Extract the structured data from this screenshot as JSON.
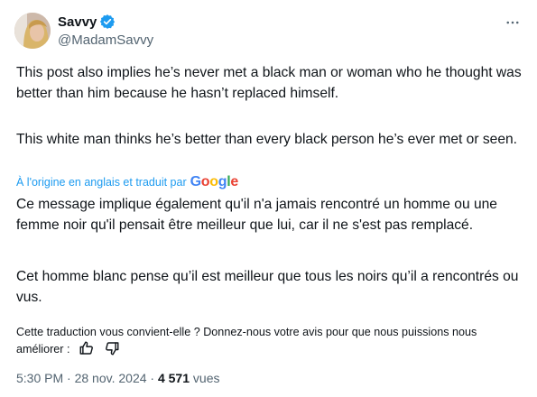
{
  "author": {
    "display_name": "Savvy",
    "handle": "@MadamSavvy",
    "verified": true,
    "verified_color": "#1d9bf0"
  },
  "tweet": {
    "original_paragraphs": [
      "This post also implies he’s never met a black man or woman who he thought was better than him because he hasn’t replaced himself.",
      "This white man thinks he’s better than every black person he’s ever met or seen."
    ],
    "translation_notice": "À l'origine en anglais et traduit par",
    "translation_provider": "Google",
    "translated_paragraphs": [
      "Ce message implique également qu'il n'a jamais rencontré un homme ou une femme noir qu'il pensait être meilleur que lui, car il ne s'est pas remplacé.",
      "Cet homme blanc pense qu’il est meilleur que tous les noirs qu’il a rencontrés ou vus."
    ],
    "feedback_prompt": "Cette traduction vous convient-elle ? Donnez-nous votre avis pour que nous puissions nous améliorer :",
    "time": "5:30 PM",
    "separator": "·",
    "date": "28 nov. 2024",
    "views_count": "4 571",
    "views_label": "vues"
  },
  "icons": {
    "more": "more-horizontal-icon",
    "verified": "verified-badge-icon",
    "thumbs_up": "thumbs-up-icon",
    "thumbs_down": "thumbs-down-icon"
  },
  "colors": {
    "text_primary": "#0f1419",
    "text_secondary": "#536471",
    "link_blue": "#1d9bf0"
  }
}
